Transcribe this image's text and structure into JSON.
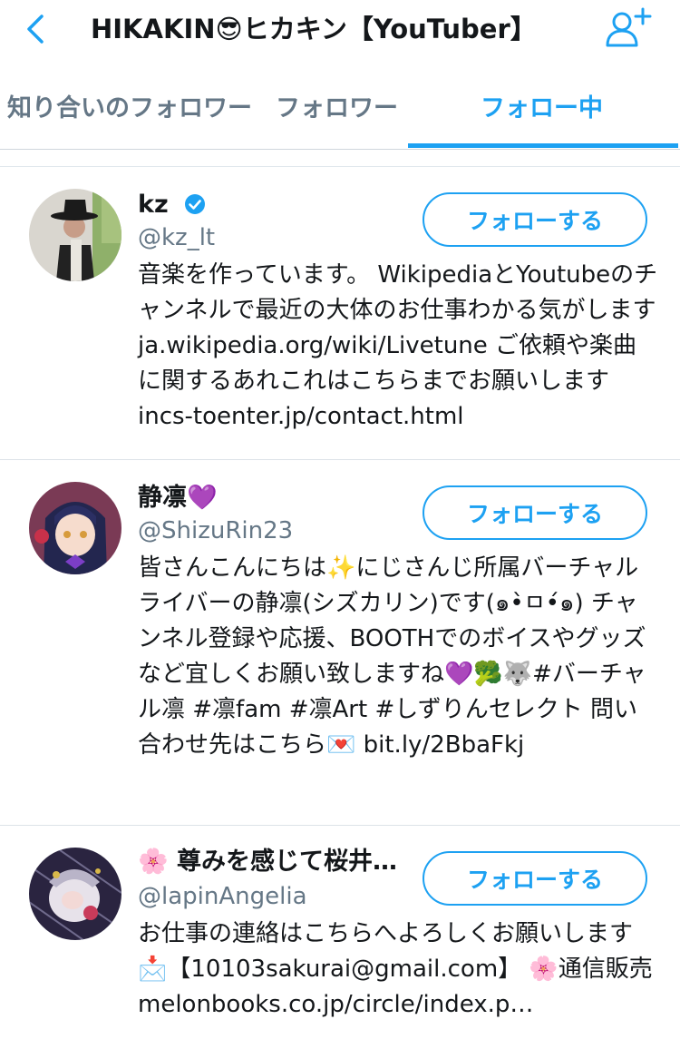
{
  "header": {
    "title": "HIKAKIN😎ヒカキン【YouTuber】",
    "back_icon": "chevron-left-icon",
    "add_user_icon": "add-user-icon"
  },
  "tabs": [
    {
      "label": "知り合いのフォロワー",
      "active": false
    },
    {
      "label": "フォロワー",
      "active": false
    },
    {
      "label": "フォロー中",
      "active": true
    }
  ],
  "colors": {
    "accent": "#1da1f2",
    "secondary_text": "#657786"
  },
  "users": [
    {
      "name": "kz",
      "verified": true,
      "handle": "@kz_lt",
      "follow_label": "フォローする",
      "bio": "音楽を作っています。 WikipediaとYoutubeのチャンネルで最近の大体のお仕事わかる気がします ja.wikipedia.org/wiki/Livetune ご依頼や楽曲に関するあれこれはこちらまでお願いします incs-toenter.jp/contact.html"
    },
    {
      "name": "静凛💜",
      "verified": false,
      "handle": "@ShizuRin23",
      "follow_label": "フォローする",
      "bio": "皆さんこんにちは✨にじさんじ所属バーチャルライバーの静凛(シズカリン)です(๑•̀ㅁ•́๑) チャンネル登録や応援、BOOTHでのボイスやグッズなど宜しくお願い致しますね💜🥦🐺#バーチャル凛 #凛fam #凛Art #しずりんセレクト 問い合わせ先はこちら💌 bit.ly/2BbaFkj"
    },
    {
      "name": "🌸 尊みを感じて桜井…",
      "verified": false,
      "handle": "@lapinAngelia",
      "follow_label": "フォローする",
      "bio": "お仕事の連絡はこちらへよろしくお願いします📩【10103sakurai@gmail.com】 🌸通信販売 melonbooks.co.jp/circle/index.p…"
    }
  ]
}
